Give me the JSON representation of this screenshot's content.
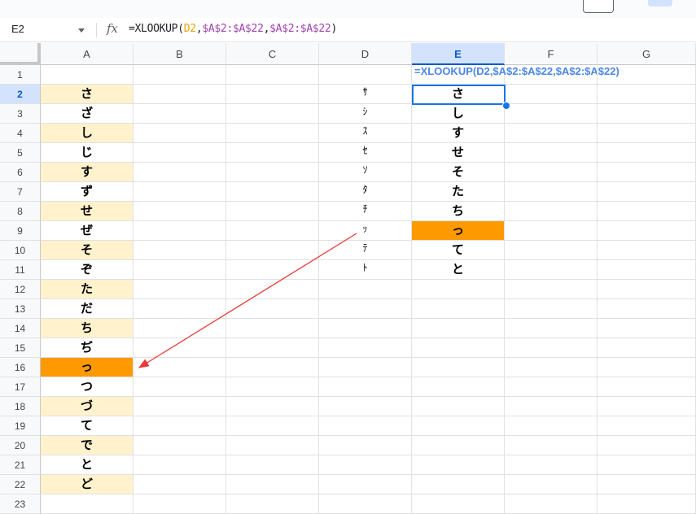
{
  "name_box": "E2",
  "formula": {
    "prefix": "=XLOOKUP(",
    "ref1": "D2",
    "sep1": ",",
    "ref2": "$A$2:$A$22",
    "sep2": ",",
    "ref3": "$A$2:$A$22",
    "suffix": ")"
  },
  "columns": [
    "A",
    "B",
    "C",
    "D",
    "E",
    "F",
    "G"
  ],
  "rows": [
    "1",
    "2",
    "3",
    "4",
    "5",
    "6",
    "7",
    "8",
    "9",
    "10",
    "11",
    "12",
    "13",
    "14",
    "15",
    "16",
    "17",
    "18",
    "19",
    "20",
    "21",
    "22",
    "23"
  ],
  "colA": [
    "さ",
    "ざ",
    "し",
    "じ",
    "す",
    "ず",
    "せ",
    "ぜ",
    "そ",
    "ぞ",
    "た",
    "だ",
    "ち",
    "ぢ",
    "っ",
    "つ",
    "づ",
    "て",
    "で",
    "と",
    "ど"
  ],
  "colD": [
    "ｻ",
    "ｼ",
    "ｽ",
    "ｾ",
    "ｿ",
    "ﾀ",
    "ﾁ",
    "ｯ",
    "ﾃ",
    "ﾄ"
  ],
  "colE": [
    "さ",
    "し",
    "す",
    "せ",
    "そ",
    "た",
    "ち",
    "っ",
    "て",
    "と"
  ],
  "e1_formula_text": "=XLOOKUP(D2,$A$2:$A$22,$A$2:$A$22)",
  "colors": {
    "light_fill": "#fff2cc",
    "orange_fill": "#ff9900",
    "selection": "#1a73e8",
    "arrow": "#e53935",
    "formula_text": "#4a86e8"
  }
}
